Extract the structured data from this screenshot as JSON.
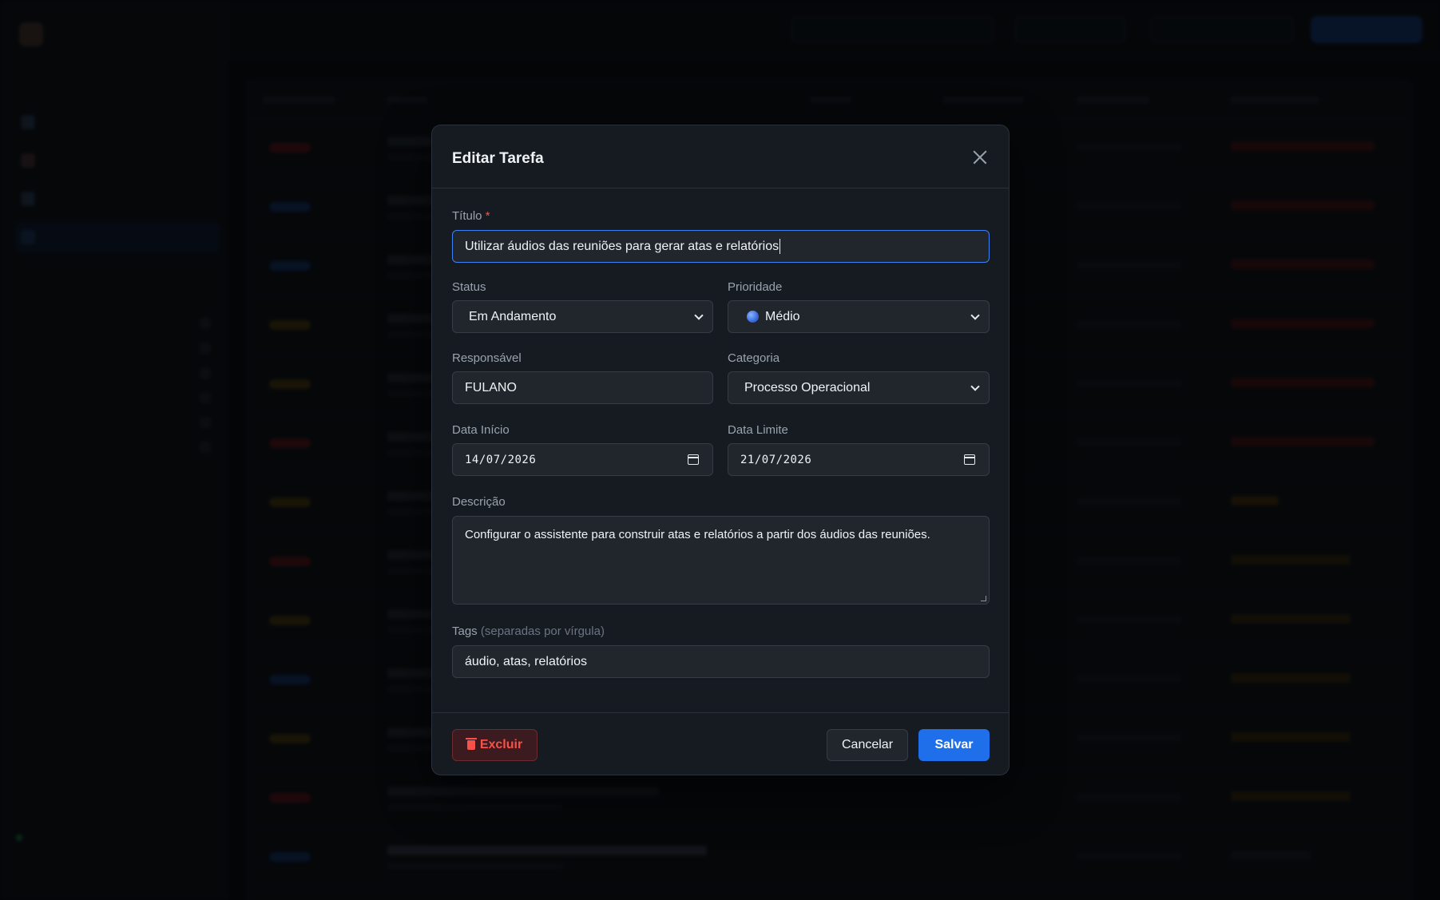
{
  "modal": {
    "title": "Editar Tarefa",
    "titulo_label": "Título",
    "required_mark": "*",
    "titulo_value": "Utilizar áudios das reuniões para gerar atas e relatórios",
    "status_label": "Status",
    "status_value": "Em Andamento",
    "prioridade_label": "Prioridade",
    "prioridade_value": "Médio",
    "responsavel_label": "Responsável",
    "responsavel_value": "FULANO",
    "categoria_label": "Categoria",
    "categoria_value": "Processo Operacional",
    "data_inicio_label": "Data Início",
    "data_inicio_value": "14/07/2026",
    "data_limite_label": "Data Limite",
    "data_limite_value": "21/07/2026",
    "descricao_label": "Descrição",
    "descricao_value": "Configurar o assistente para construir atas e relatórios a partir dos áudios das reuniões.",
    "tags_label": "Tags",
    "tags_hint": "(separadas por vírgula)",
    "tags_value": "áudio, atas, relatórios",
    "delete_label": "Excluir",
    "cancel_label": "Cancelar",
    "save_label": "Salvar"
  },
  "colors": {
    "accent": "#1f6feb",
    "danger": "#f85149",
    "modal_bg": "#161b22",
    "input_bg": "#21262d"
  },
  "icons": {
    "close": "close-icon",
    "delete": "trash-icon",
    "priority": "blue-circle-icon",
    "date": "calendar-icon",
    "select": "chevron-down-icon"
  }
}
